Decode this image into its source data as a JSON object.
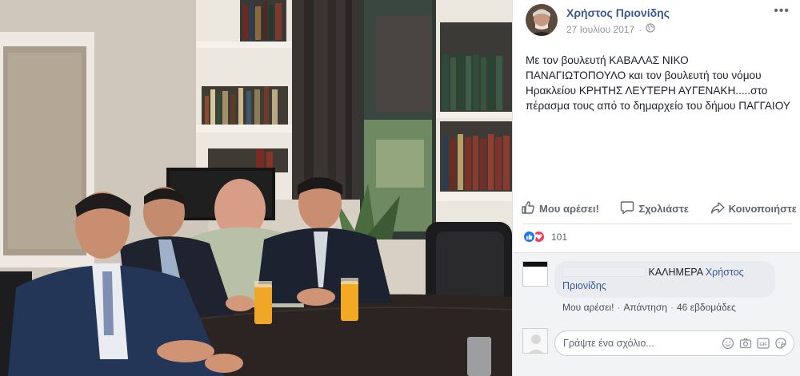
{
  "post": {
    "author": "Χρήστος Πριονίδης",
    "date": "27 Ιουλίου 2017",
    "more_label": "•••",
    "text": "Με τον βουλευτή ΚΑΒΑΛΑΣ ΝΙΚΟ ΠΑΝΑΓΙΩΤΟΠΟΥΛΟ και τον βουλευτή του νόμου Ηρακλείου ΚΡΗΤΗΣ ΛΕΥΤΕΡΗ ΑΥΓΕΝΑΚΗ.....στο πέρασμα τους από το δημαρχείο του δήμου ΠΑΓΓΑΙΟΥ",
    "privacy_icon": "globe-icon"
  },
  "actions": {
    "like": "Μου αρέσει!",
    "comment": "Σχολιάστε",
    "share": "Κοινοποιήστε"
  },
  "reactions": {
    "count": "101",
    "types": [
      "like",
      "love"
    ]
  },
  "comment": {
    "text": "ΚΑΛΗΜΕΡΑ",
    "mention": "Χρήστος Πριονίδης",
    "like": "Μου αρέσει!",
    "reply": "Απάντηση",
    "separator": "·",
    "time": "46 εβδομάδες"
  },
  "composer": {
    "placeholder": "Γράψτε ένα σχόλιο..."
  },
  "colors": {
    "link": "#385898",
    "like_blue": "#1877f2",
    "love_red": "#f33e58",
    "comment_bg": "#f2f3f5"
  }
}
